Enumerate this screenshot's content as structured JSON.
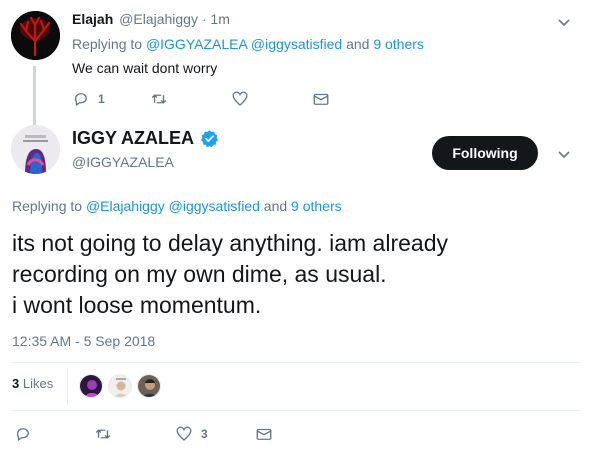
{
  "reply_tweet": {
    "display_name": "Elajah",
    "handle": "@Elajahiggy",
    "time_sep": "·",
    "time": "1m",
    "replying_to_prefix": "Replying to",
    "replying_to_users": "@IGGYAZALEA @iggysatisfied",
    "replying_to_and": "and",
    "replying_to_others": "9 others",
    "text": "We can wait dont worry",
    "reply_count": "1",
    "retweet_count": "",
    "like_count": ""
  },
  "main_tweet": {
    "display_name": "IGGY AZALEA",
    "handle": "@IGGYAZALEA",
    "follow_button_label": "Following",
    "replying_to_prefix": "Replying to",
    "replying_to_users": "@Elajahiggy @iggysatisfied",
    "replying_to_and": "and",
    "replying_to_others": "9 others",
    "text_lines": [
      "its not going to delay anything. iam already",
      "recording on my own dime, as usual.",
      "i wont loose momentum."
    ],
    "timestamp": "12:35 AM - 5 Sep 2018",
    "likes_count": "3",
    "likes_label": "Likes",
    "reply_count": "",
    "retweet_count": "",
    "like_count": "3"
  },
  "colors": {
    "link": "#1b95e0",
    "muted": "#657786",
    "verified": "#1da1f2",
    "follow_button_bg": "#14171a"
  },
  "icons": [
    "reply-icon",
    "retweet-icon",
    "like-icon",
    "dm-icon",
    "chevron-down-icon",
    "verified-badge-icon"
  ]
}
